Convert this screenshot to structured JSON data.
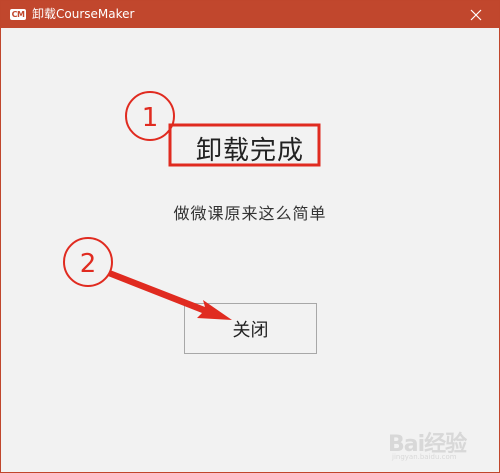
{
  "window": {
    "title": "卸载CourseMaker",
    "icon_text": "CM",
    "accent_color": "#c1472d"
  },
  "main": {
    "headline": "卸载完成",
    "subtitle": "做微课原来这么简单",
    "close_button_label": "关闭"
  },
  "annotations": {
    "step1": "1",
    "step2": "2",
    "color": "#e02b20"
  },
  "watermark": {
    "text": "Bai经验",
    "sub": "jingyan.baidu.com"
  }
}
